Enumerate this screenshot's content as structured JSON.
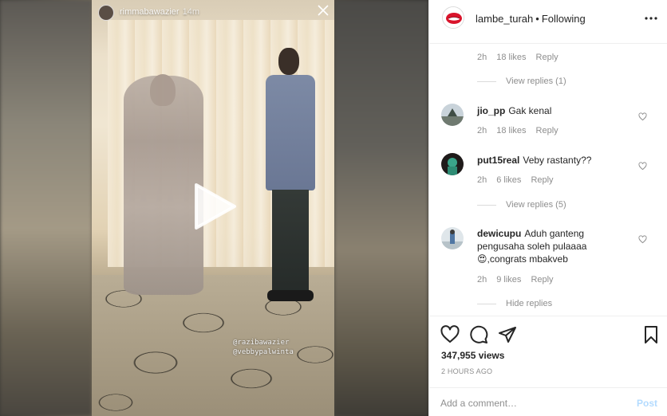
{
  "story": {
    "username": "rimmabawazier",
    "time": "14m",
    "sticker_lines": [
      "@razibawazier",
      "@vebbypalwinta"
    ]
  },
  "post": {
    "author": "lambe_turah",
    "follow_status": "Following"
  },
  "comments": [
    {
      "meta_time": "2h",
      "meta_likes": "18 likes",
      "meta_reply": "Reply",
      "view_replies": "View replies (1)"
    },
    {
      "username": "jio_pp",
      "text": "Gak kenal",
      "time": "2h",
      "likes": "18 likes",
      "reply": "Reply"
    },
    {
      "username": "put15real",
      "text": "Veby rastanty??",
      "time": "2h",
      "likes": "6 likes",
      "reply": "Reply",
      "view_replies": "View replies (5)"
    },
    {
      "username": "dewicupu",
      "text": "Aduh ganteng pengusaha soleh pulaaaa",
      "text2": ",congrats mbakveb",
      "emoji": "😍",
      "time": "2h",
      "likes": "9 likes",
      "reply": "Reply",
      "hide_replies": "Hide replies"
    }
  ],
  "actions": {
    "views": "347,955 views",
    "timestamp": "2 HOURS AGO"
  },
  "comment_box": {
    "placeholder": "Add a comment…",
    "post_label": "Post"
  },
  "colors": {
    "text": "#262626",
    "muted": "#8e8e8e",
    "post_disabled": "#b3dbff",
    "border": "#efefef"
  }
}
